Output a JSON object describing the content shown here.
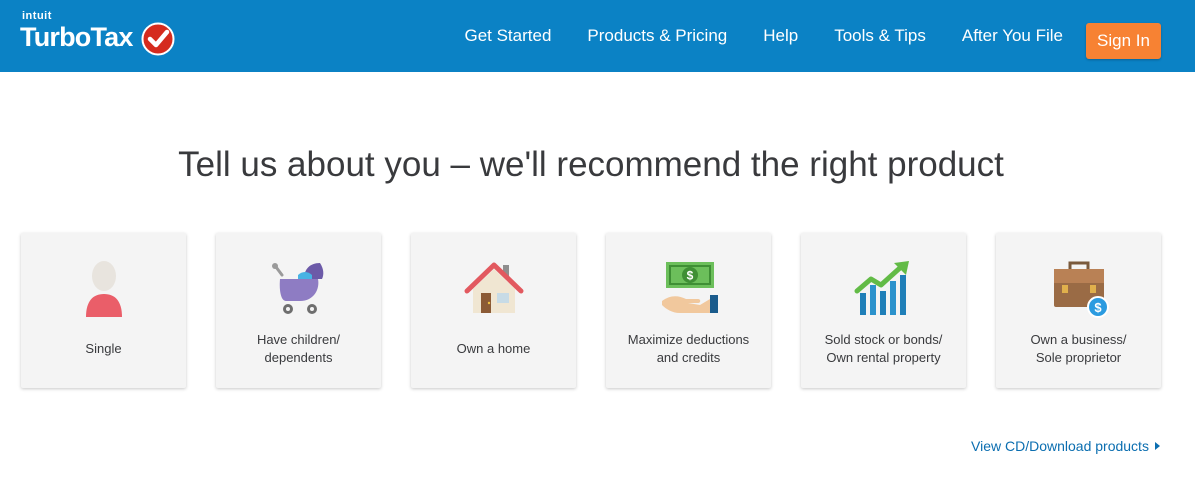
{
  "header": {
    "logo_brand_small": "intuit",
    "logo_brand": "TurboTax",
    "nav": [
      {
        "label": "Get Started"
      },
      {
        "label": "Products & Pricing"
      },
      {
        "label": "Help"
      },
      {
        "label": "Tools & Tips"
      },
      {
        "label": "After You File"
      }
    ],
    "signin_label": "Sign In"
  },
  "main": {
    "headline": "Tell us about you – we'll recommend the right product",
    "cards": [
      {
        "line1": "Single",
        "line2": "",
        "icon": "person-icon"
      },
      {
        "line1": "Have children/",
        "line2": "dependents",
        "icon": "stroller-icon"
      },
      {
        "line1": "Own a home",
        "line2": "",
        "icon": "house-icon"
      },
      {
        "line1": "Maximize deductions",
        "line2": "and credits",
        "icon": "money-hand-icon"
      },
      {
        "line1": "Sold stock or bonds/",
        "line2": "Own rental property",
        "icon": "stock-chart-icon"
      },
      {
        "line1": "Own a business/",
        "line2": "Sole proprietor",
        "icon": "briefcase-icon"
      }
    ],
    "cd_link": "View CD/Download products"
  },
  "colors": {
    "header_bg": "#0b82c5",
    "signin_bg": "#f78233",
    "link": "#0b6eb0",
    "card_bg": "#f4f4f4"
  }
}
